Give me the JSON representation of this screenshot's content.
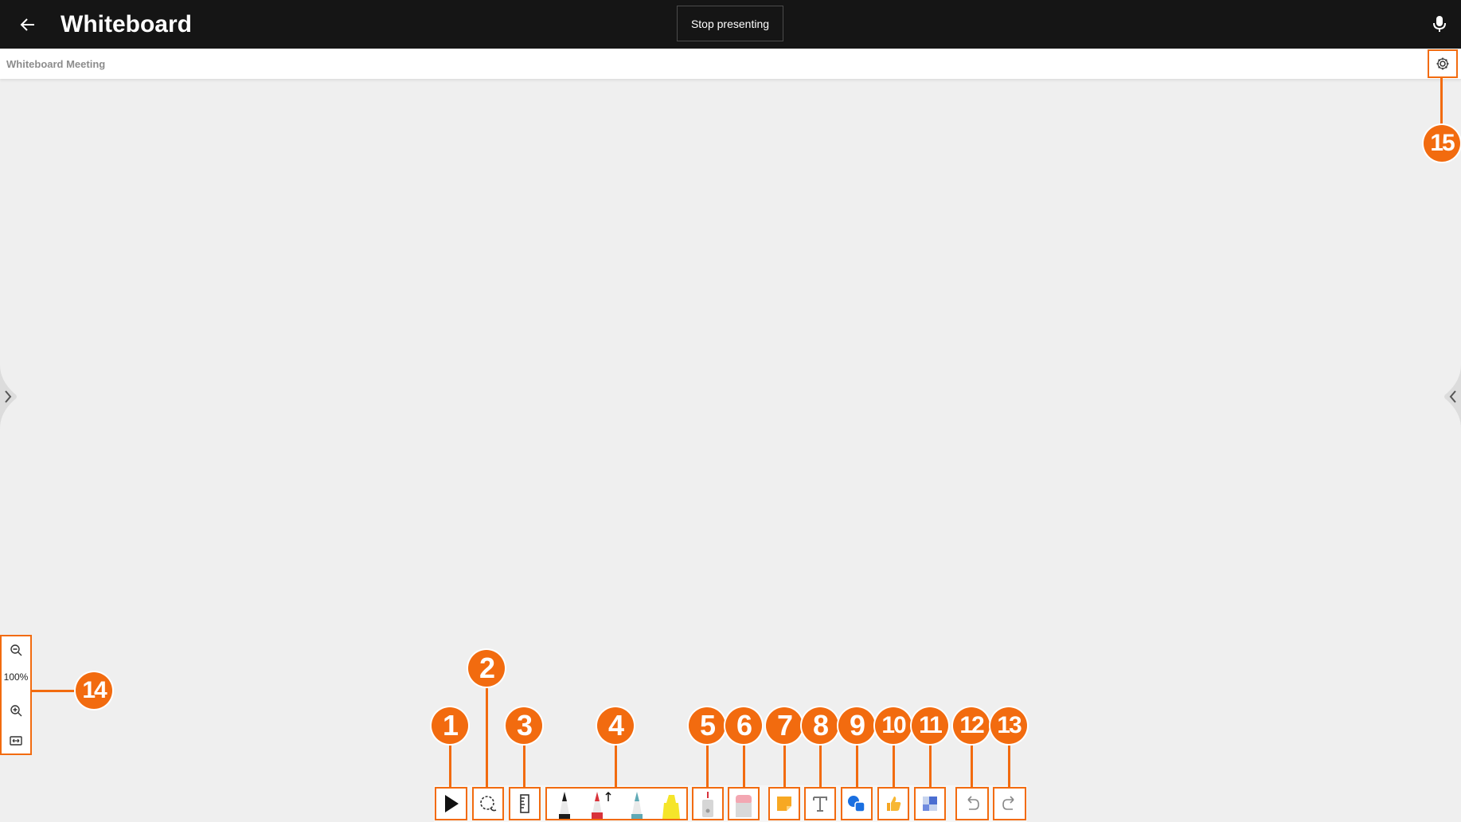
{
  "header": {
    "back_icon": "arrow-left-icon",
    "title": "Whiteboard",
    "stop_presenting": "Stop presenting",
    "mic_icon": "microphone-icon"
  },
  "subheader": {
    "meeting_name": "Whiteboard Meeting",
    "settings_icon": "gear-icon"
  },
  "zoom": {
    "zoom_out_icon": "zoom-out-icon",
    "level": "100%",
    "zoom_in_icon": "zoom-in-icon",
    "fit_icon": "fit-to-screen-icon"
  },
  "toolbar": {
    "tools": [
      {
        "name": "select",
        "icon": "pointer-arrow-icon"
      },
      {
        "name": "lasso",
        "icon": "lasso-icon"
      },
      {
        "name": "ruler",
        "icon": "ruler-icon"
      },
      {
        "name": "pens",
        "icons": [
          "black-pen-icon",
          "red-pen-icon",
          "teal-pen-icon",
          "yellow-highlighter-icon"
        ]
      },
      {
        "name": "stroke-eraser",
        "icon": "stroke-eraser-icon"
      },
      {
        "name": "eraser",
        "icon": "eraser-icon"
      },
      {
        "name": "sticky-note",
        "icon": "sticky-note-icon"
      },
      {
        "name": "text",
        "icon": "text-icon"
      },
      {
        "name": "shapes",
        "icon": "shapes-icon"
      },
      {
        "name": "reactions",
        "icon": "thumbs-up-icon"
      },
      {
        "name": "templates",
        "icon": "templates-icon"
      },
      {
        "name": "undo",
        "icon": "undo-icon"
      },
      {
        "name": "redo",
        "icon": "redo-icon"
      }
    ]
  },
  "callouts": [
    "1",
    "2",
    "3",
    "4",
    "5",
    "6",
    "7",
    "8",
    "9",
    "10",
    "11",
    "12",
    "13",
    "14",
    "15"
  ],
  "colors": {
    "callout": "#f26b0f",
    "topbar": "#151515",
    "canvas": "#efefef",
    "pen_black": "#1b1b1b",
    "pen_red": "#d8323a",
    "pen_teal": "#5fa9b5",
    "highlighter_yellow": "#f5e52a",
    "sticky": "#f7a823",
    "shapes_blue": "#1a6fe0"
  }
}
